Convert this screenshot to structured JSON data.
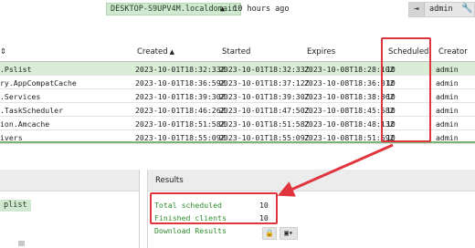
{
  "topbar": {
    "client_id": "DESKTOP-S9UPV4M.localdomain",
    "last_seen": "10 hours ago",
    "username": "admin"
  },
  "table": {
    "columns": {
      "name": "",
      "created": "Created",
      "started": "Started",
      "expires": "Expires",
      "scheduled": "Scheduled",
      "creator": "Creator"
    },
    "rows": [
      {
        "name": ".Pslist",
        "created": "2023-10-01T18:32:33Z",
        "started": "2023-10-01T18:32:33Z",
        "expires": "2023-10-08T18:28:10Z",
        "scheduled": "10",
        "creator": "admin"
      },
      {
        "name": "ry.AppCompatCache",
        "created": "2023-10-01T18:36:59Z",
        "started": "2023-10-01T18:37:12Z",
        "expires": "2023-10-08T18:36:01Z",
        "scheduled": "10",
        "creator": "admin"
      },
      {
        "name": ".Services",
        "created": "2023-10-01T18:39:30Z",
        "started": "2023-10-01T18:39:30Z",
        "expires": "2023-10-08T18:38:36Z",
        "scheduled": "10",
        "creator": "admin"
      },
      {
        "name": ".TaskScheduler",
        "created": "2023-10-01T18:46:26Z",
        "started": "2023-10-01T18:47:50Z",
        "expires": "2023-10-08T18:45:58Z",
        "scheduled": "10",
        "creator": "admin"
      },
      {
        "name": "ion.Amcache",
        "created": "2023-10-01T18:51:58Z",
        "started": "2023-10-01T18:51:58Z",
        "expires": "2023-10-08T18:48:13Z",
        "scheduled": "10",
        "creator": "admin"
      },
      {
        "name": "ivers",
        "created": "2023-10-01T18:55:09Z",
        "started": "2023-10-01T18:55:09Z",
        "expires": "2023-10-08T18:51:59Z",
        "scheduled": "10",
        "creator": "admin"
      }
    ]
  },
  "left_panel": {
    "badge": "plist"
  },
  "results": {
    "title": "Results",
    "total_scheduled_label": "Total scheduled",
    "total_scheduled_value": "10",
    "finished_clients_label": "Finished clients",
    "finished_clients_value": "10",
    "download_label": "Download Results"
  },
  "colors": {
    "accent_green": "#2e8b2e",
    "selected_row": "#d8ecd6",
    "annotation_red": "#e0353d"
  }
}
